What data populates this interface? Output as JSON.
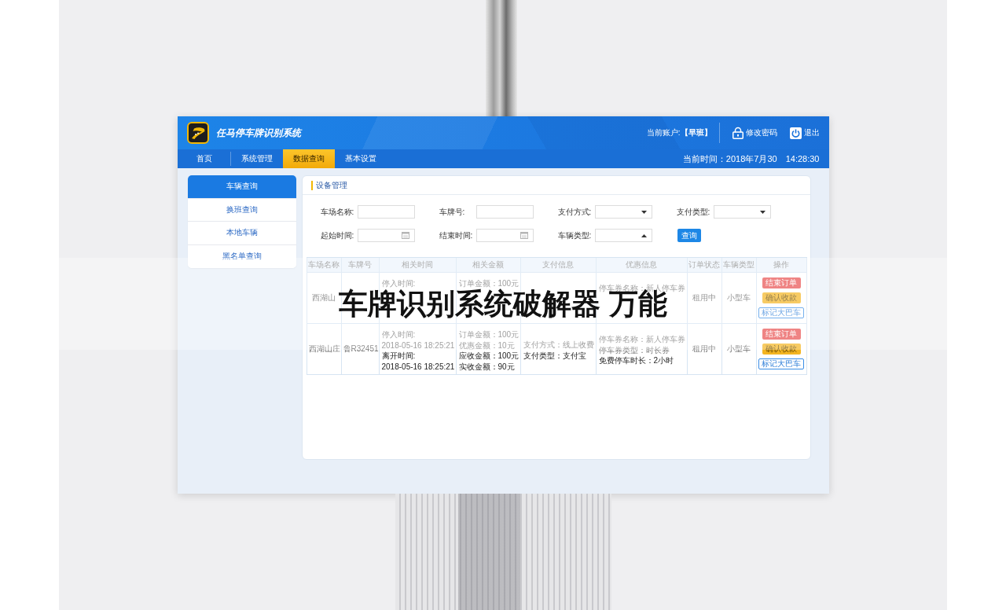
{
  "header": {
    "title": "任马停车牌识别系统",
    "account": "当前账户:**【早班】**",
    "actions": [
      {
        "label": "修改密码",
        "kind": "lock"
      },
      {
        "label": "退出",
        "kind": "power"
      }
    ]
  },
  "nav": {
    "tabs": [
      {
        "label": "首页",
        "selected": false
      },
      {
        "label": "系统管理",
        "selected": false
      },
      {
        "label": "数据查询",
        "selected": true
      },
      {
        "label": "基本设置",
        "selected": false
      }
    ],
    "date": "当前时间：2018年7月30",
    "clock": "14:28:30"
  },
  "sidebar": {
    "items": [
      {
        "label": "车辆查询",
        "selected": true
      },
      {
        "label": "换班查询",
        "selected": false
      },
      {
        "label": "本地车辆",
        "selected": false
      },
      {
        "label": "黑名单查询",
        "selected": false
      }
    ]
  },
  "panel": {
    "title": "设备管理",
    "filters": [
      {
        "label": "车场名称:",
        "kind": "text"
      },
      {
        "label": "车牌号:",
        "kind": "text"
      },
      {
        "label": "支付方式:",
        "kind": "select",
        "expanded": false
      },
      {
        "label": "支付类型:",
        "kind": "select",
        "expanded": false
      },
      {
        "label": "起始时间:",
        "kind": "date"
      },
      {
        "label": "结束时间:",
        "kind": "date"
      },
      {
        "label": "车辆类型:",
        "kind": "select",
        "expanded": true
      }
    ],
    "search_button": "查询",
    "table": {
      "columns": [
        "车场名称",
        "车牌号",
        "相关时间",
        "相关金额",
        "支付信息",
        "优惠信息",
        "订单状态",
        "车辆类型",
        "操作"
      ],
      "rows": [
        {
          "venue": "西湖山",
          "time_lines": [
            {
              "text": "停入时间:",
              "strong": false
            }
          ],
          "amount_lines": [
            {
              "text": "订单金额：100元",
              "strong": false
            }
          ],
          "discount_lines": [
            {
              "text": "停车券名称：新人停车券",
              "strong": false
            }
          ],
          "status": "租用中",
          "vehicle_type": "小型车",
          "actions": [
            {
              "label": "结束订单",
              "kind": "end"
            },
            {
              "label": "确认收款",
              "kind": "confirm"
            },
            {
              "label": "标记大巴车",
              "kind": "mark"
            }
          ]
        },
        {
          "venue": "西湖山庄",
          "plate": "鲁R32451",
          "time_lines": [
            {
              "text": "停入时间:",
              "strong": false
            },
            {
              "text": "2018-05-16 18:25:21",
              "strong": false
            },
            {
              "text": "离开时间:",
              "strong": true
            },
            {
              "text": "2018-05-16 18:25:21",
              "strong": true
            }
          ],
          "amount_lines": [
            {
              "text": "订单金额：100元",
              "strong": false
            },
            {
              "text": "优惠金额：10元",
              "strong": false
            },
            {
              "text": "应收金额：100元",
              "strong": true
            },
            {
              "text": "实收金额：90元",
              "strong": true
            }
          ],
          "payment_lines": [
            {
              "text": "支付方式：线上收费",
              "strong": false
            },
            {
              "text": "支付类型：支付宝",
              "strong": true
            }
          ],
          "discount_lines": [
            {
              "text": "停车券名称：新人停车券",
              "strong": false
            },
            {
              "text": "停车券类型：时长券",
              "strong": false
            },
            {
              "text": "免费停车时长：2小时",
              "strong": true
            }
          ],
          "status": "租用中",
          "vehicle_type": "小型车",
          "actions": [
            {
              "label": "结束订单",
              "kind": "end"
            },
            {
              "label": "确认收款",
              "kind": "confirm"
            },
            {
              "label": "标记大巴车",
              "kind": "mark"
            }
          ]
        }
      ]
    }
  },
  "overlay_caption": "车牌识别系统破解器 万能"
}
